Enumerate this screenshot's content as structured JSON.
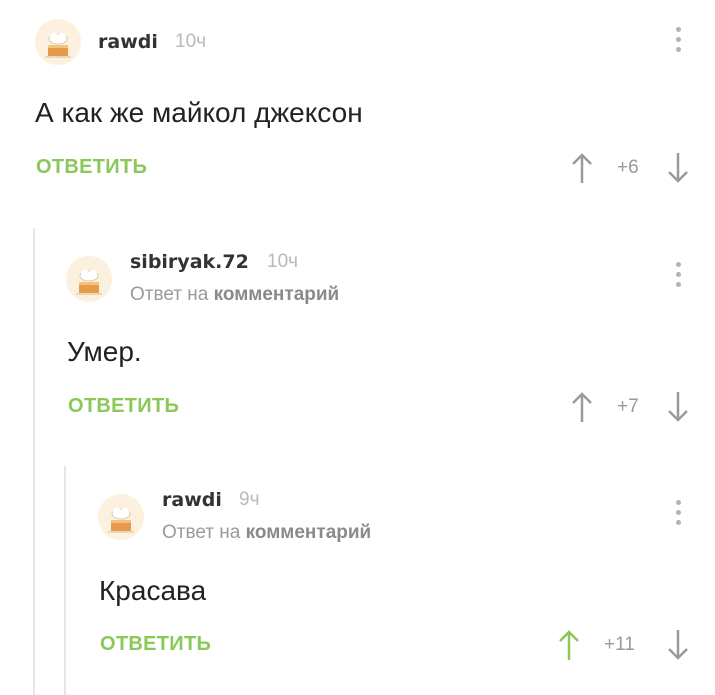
{
  "comments": [
    {
      "username": "rawdi",
      "time": "10ч",
      "reply_prefix": "",
      "reply_link": "",
      "text": "А как же майкол джексон",
      "reply_label": "ОТВЕТИТЬ",
      "rating": "+6",
      "upvoted": false
    },
    {
      "username": "sibiryak.72",
      "time": "10ч",
      "reply_prefix": "Ответ на",
      "reply_link": "комментарий",
      "text": "Умер.",
      "reply_label": "ОТВЕТИТЬ",
      "rating": "+7",
      "upvoted": false
    },
    {
      "username": "rawdi",
      "time": "9ч",
      "reply_prefix": "Ответ на",
      "reply_link": "комментарий",
      "text": "Красава",
      "reply_label": "ОТВЕТИТЬ",
      "rating": "+11",
      "upvoted": true
    }
  ],
  "colors": {
    "accent_green": "#8ac858",
    "arrow_gray": "#9a9a9a",
    "avatar_bg": "#fbf1de"
  },
  "icons": {
    "avatar": "cake-avatar-icon",
    "menu": "more-vertical-icon",
    "upvote": "arrow-up-icon",
    "downvote": "arrow-down-icon"
  }
}
